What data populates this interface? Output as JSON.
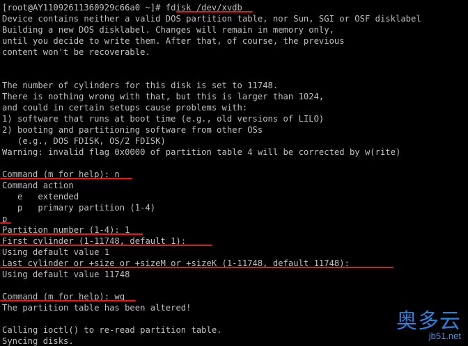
{
  "terminal": {
    "lines": [
      "[root@AY11092611360929c66a0 ~]# fdisk /dev/xvdb",
      "Device contains neither a valid DOS partition table, nor Sun, SGI or OSF disklabel",
      "Building a new DOS disklabel. Changes will remain in memory only,",
      "until you decide to write them. After that, of course, the previous",
      "content won't be recoverable.",
      "",
      "",
      "The number of cylinders for this disk is set to 11748.",
      "There is nothing wrong with that, but this is larger than 1024,",
      "and could in certain setups cause problems with:",
      "1) software that runs at boot time (e.g., old versions of LILO)",
      "2) booting and partitioning software from other OSs",
      "   (e.g., DOS FDISK, OS/2 FDISK)",
      "Warning: invalid flag 0x0000 of partition table 4 will be corrected by w(rite)",
      "",
      "Command (m for help): n",
      "Command action",
      "   e   extended",
      "   p   primary partition (1-4)",
      "p",
      "Partition number (1-4): 1",
      "First cylinder (1-11748, default 1):",
      "Using default value 1",
      "Last cylinder or +size or +sizeM or +sizeK (1-11748, default 11748):",
      "Using default value 11748",
      "",
      "Command (m for help): wq",
      "The partition table has been altered!",
      "",
      "Calling ioctl() to re-read partition table.",
      "Syncing disks."
    ]
  },
  "watermark": {
    "brand": "奥多云",
    "site": "jb51.net"
  },
  "colors": {
    "background": "#000000",
    "text": "#c0c0c0",
    "underline": "#e81818",
    "watermark": "#2f7fd8"
  }
}
